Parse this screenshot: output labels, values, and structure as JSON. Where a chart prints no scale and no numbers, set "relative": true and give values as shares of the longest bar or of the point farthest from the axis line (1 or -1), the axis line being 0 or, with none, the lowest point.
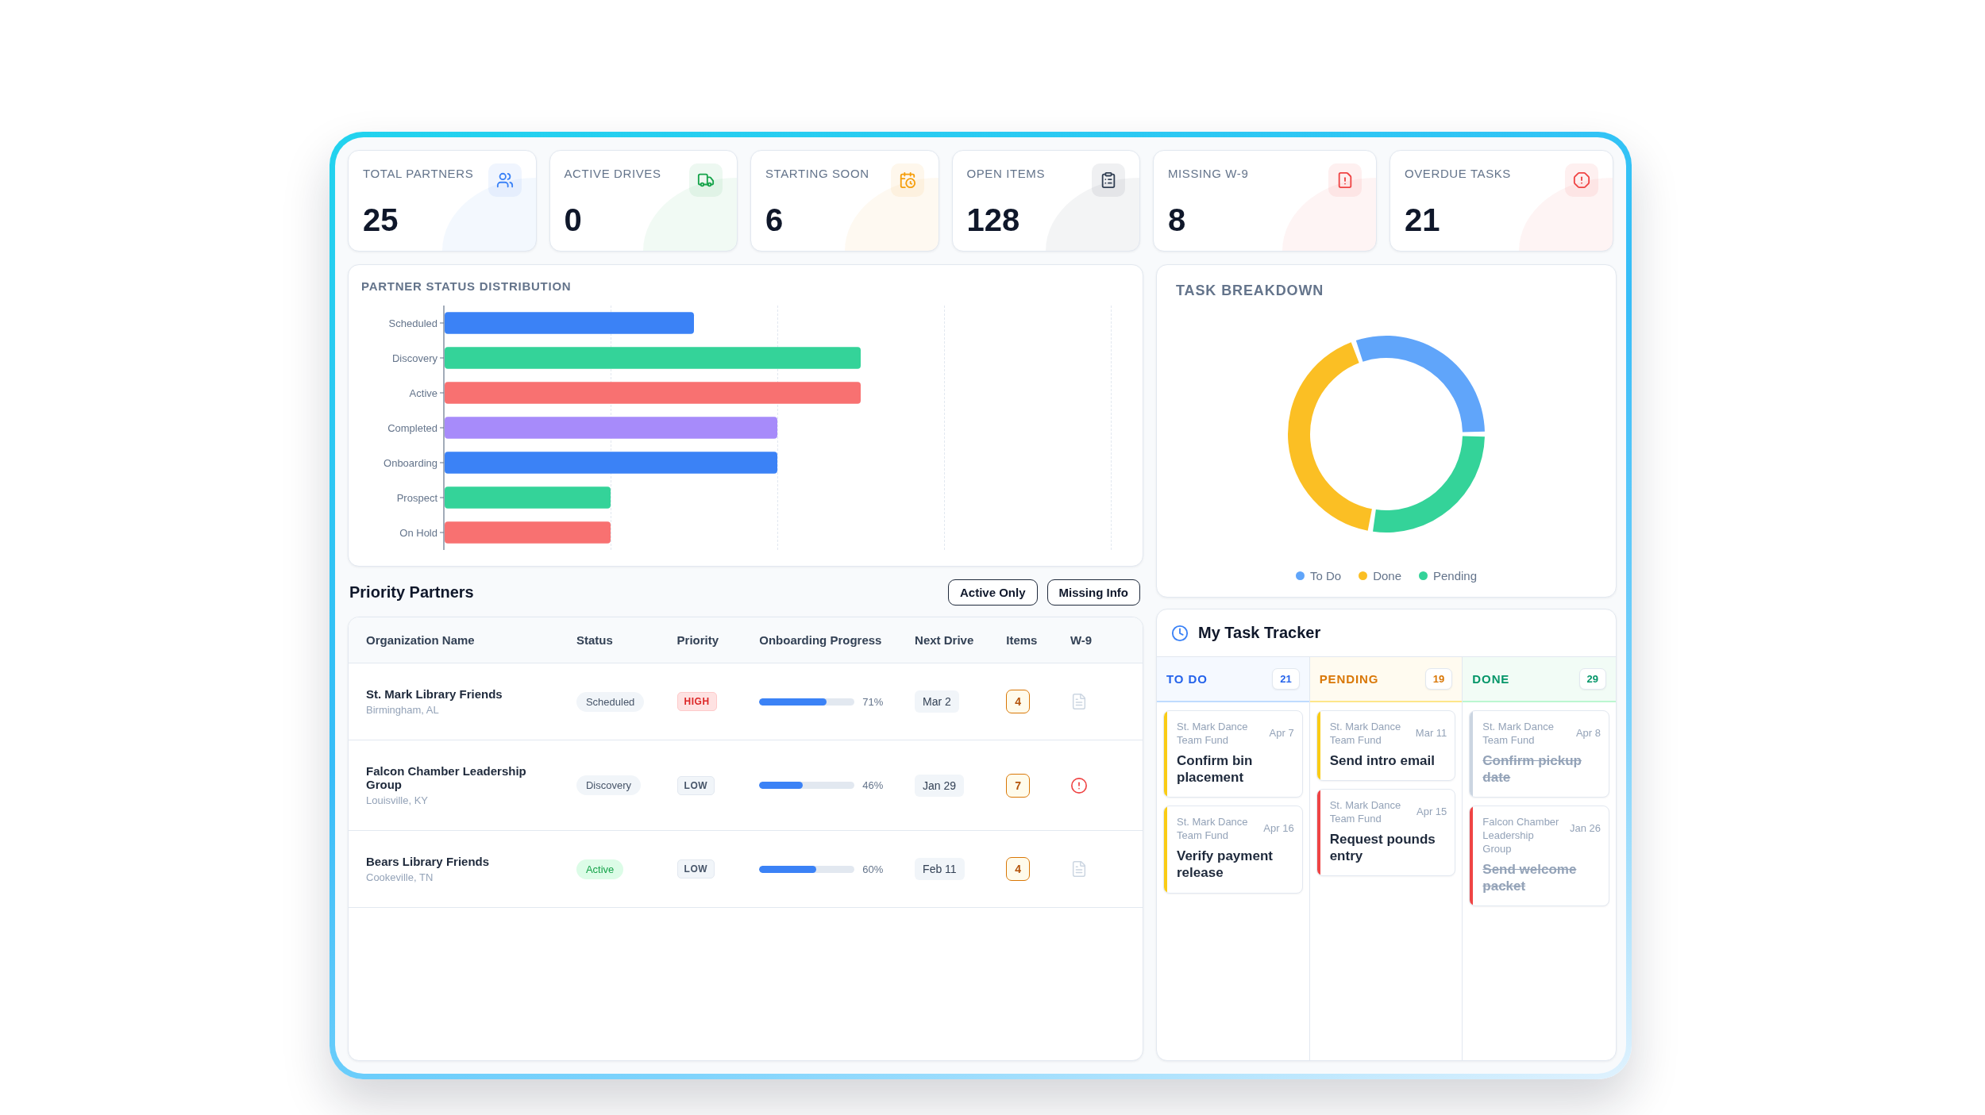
{
  "stats": [
    {
      "label": "TOTAL PARTNERS",
      "value": "25",
      "color": "#3b82f6"
    },
    {
      "label": "ACTIVE DRIVES",
      "value": "0",
      "color": "#16a34a"
    },
    {
      "label": "STARTING SOON",
      "value": "6",
      "color": "#f59e0b"
    },
    {
      "label": "OPEN ITEMS",
      "value": "128",
      "color": "#334155"
    },
    {
      "label": "MISSING W-9",
      "value": "8",
      "color": "#ef4444"
    },
    {
      "label": "OVERDUE TASKS",
      "value": "21",
      "color": "#ef4444"
    }
  ],
  "partner_status": {
    "title": "PARTNER STATUS DISTRIBUTION",
    "chart_data": {
      "type": "bar",
      "orientation": "horizontal",
      "relative": true,
      "categories": [
        "Scheduled",
        "Discovery",
        "Active",
        "Completed",
        "Onboarding",
        "Prospect",
        "On Hold"
      ],
      "values": [
        0.6,
        1,
        1,
        0.8,
        0.8,
        0.4,
        0.4
      ],
      "colors": [
        "#3b82f6",
        "#34d399",
        "#f87171",
        "#a78bfa",
        "#3b82f6",
        "#34d399",
        "#f87171"
      ],
      "tick_labels": "y"
    }
  },
  "priority_partners": {
    "title": "Priority Partners",
    "filters": [
      "Active Only",
      "Missing Info"
    ],
    "columns": [
      "Organization Name",
      "Status",
      "Priority",
      "Onboarding Progress",
      "Next Drive",
      "Items",
      "W-9"
    ],
    "rows": [
      {
        "organization": "St. Mark Library Friends",
        "location": "Birmingham, AL",
        "status": {
          "label": "Scheduled",
          "kind": "neutral"
        },
        "priority": {
          "label": "HIGH",
          "kind": "high"
        },
        "progress": {
          "level": 0.71,
          "reading": "71%"
        },
        "next_drive": "Mar 2",
        "items": "4",
        "w9_missing": false
      },
      {
        "organization": "Falcon Chamber Leadership Group",
        "location": "Louisville, KY",
        "status": {
          "label": "Discovery",
          "kind": "neutral"
        },
        "priority": {
          "label": "LOW",
          "kind": "low"
        },
        "progress": {
          "level": 0.46,
          "reading": "46%"
        },
        "next_drive": "Jan 29",
        "items": "7",
        "w9_missing": true
      },
      {
        "organization": "Bears Library Friends",
        "location": "Cookeville, TN",
        "status": {
          "label": "Active",
          "kind": "success"
        },
        "priority": {
          "label": "LOW",
          "kind": "low"
        },
        "progress": {
          "level": 0.6,
          "reading": "60%"
        },
        "next_drive": "Feb 11",
        "items": "4",
        "w9_missing": false
      }
    ]
  },
  "task_breakdown": {
    "title": "TASK BREAKDOWN",
    "chart_data": {
      "type": "donut",
      "categories": [
        "To Do",
        "Done",
        "Pending"
      ],
      "values": [
        30.4,
        42.0,
        27.6
      ],
      "colors": [
        "#60a5fa",
        "#fbbf24",
        "#34d399"
      ]
    }
  },
  "task_tracker": {
    "title": "My Task Tracker",
    "columns": [
      {
        "title": "TO DO",
        "count": "21",
        "kind": "todo",
        "tasks": [
          {
            "organization": "St. Mark Dance Team Fund",
            "date": "Apr 7",
            "title": "Confirm bin placement",
            "color": "#facc15",
            "completed": false
          },
          {
            "organization": "St. Mark Dance Team Fund",
            "date": "Apr 16",
            "title": "Verify payment release",
            "color": "#facc15",
            "completed": false
          }
        ]
      },
      {
        "title": "PENDING",
        "count": "19",
        "kind": "pending",
        "tasks": [
          {
            "organization": "St. Mark Dance Team Fund",
            "date": "Mar 11",
            "title": "Send intro email",
            "color": "#facc15",
            "completed": false
          },
          {
            "organization": "St. Mark Dance Team Fund",
            "date": "Apr 15",
            "title": "Request pounds entry",
            "color": "#ef4444",
            "completed": false
          }
        ]
      },
      {
        "title": "DONE",
        "count": "29",
        "kind": "done",
        "tasks": [
          {
            "organization": "St. Mark Dance Team Fund",
            "date": "Apr 8",
            "title": "Confirm pickup date",
            "color": "#cbd5e1",
            "completed": true
          },
          {
            "organization": "Falcon Chamber Leadership Group",
            "date": "Jan 26",
            "title": "Send welcome packet",
            "color": "#ef4444",
            "completed": true
          }
        ]
      }
    ]
  }
}
